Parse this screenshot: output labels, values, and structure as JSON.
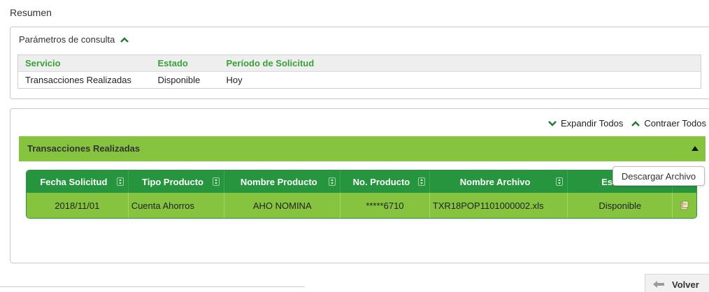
{
  "page": {
    "title": "Resumen"
  },
  "params": {
    "header": "Parámetros de consulta",
    "columns": [
      "Servicio",
      "Estado",
      "Período de Solicitud"
    ],
    "row": [
      "Transacciones Realizadas",
      "Disponible",
      "Hoy"
    ]
  },
  "results": {
    "expand_all": "Expandir Todos",
    "collapse_all": "Contraer Todos",
    "section_title": "Transacciones Realizadas",
    "columns": [
      "Fecha Solicitud",
      "Tipo Producto",
      "Nombre Producto",
      "No. Producto",
      "Nombre Archivo",
      "Estado",
      ""
    ],
    "rows": [
      [
        "2018/11/01",
        "Cuenta Ahorros",
        "AHO NOMINA",
        "*****6710",
        "TXR18POP1101000002.xls",
        "Disponible"
      ]
    ],
    "tooltip": "Descargar Archivo"
  },
  "footer": {
    "back_label": "Volver"
  },
  "colors": {
    "header_green": "#27953d",
    "row_green": "#86c43f",
    "label_green": "#38a238"
  },
  "icons": [
    "chevron-up-icon",
    "chevron-down-icon",
    "sort-icon",
    "download-file-icon",
    "back-arrow-icon"
  ]
}
